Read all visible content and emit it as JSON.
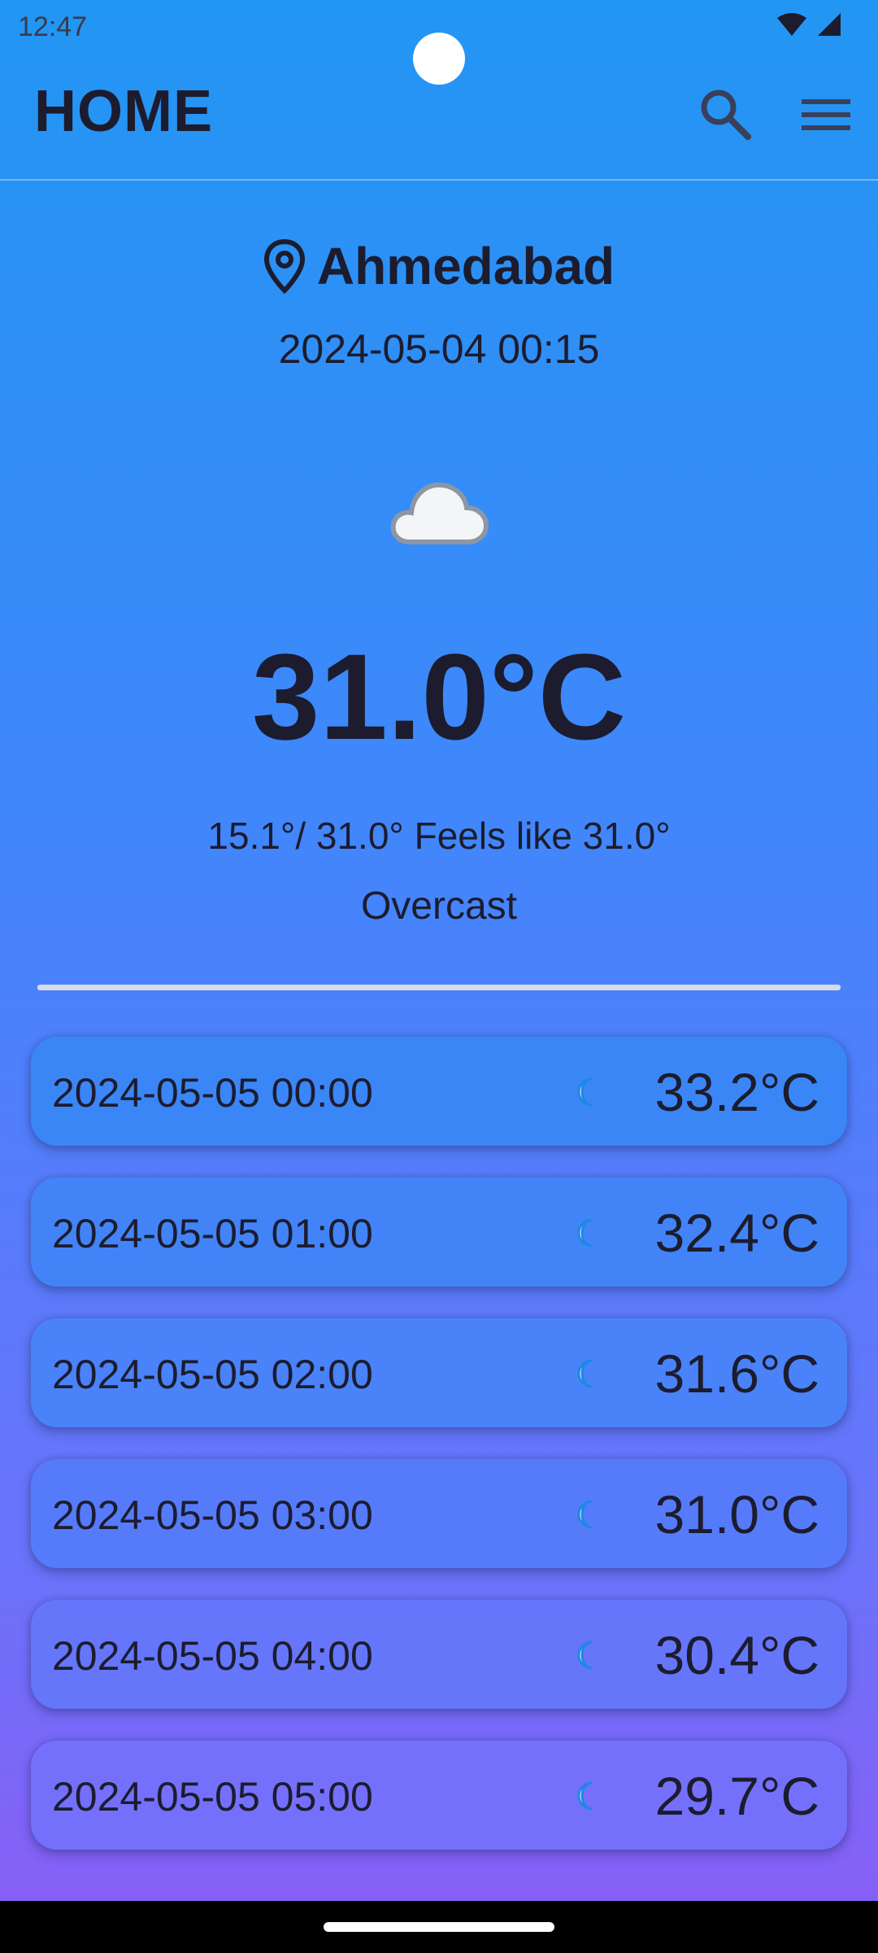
{
  "status_bar": {
    "time": "12:47"
  },
  "app_bar": {
    "title": "HOME",
    "icons": [
      "search-icon",
      "menu-icon"
    ]
  },
  "current": {
    "location": "Ahmedabad",
    "datetime": "2024-05-04 00:15",
    "temperature": "31.0°C",
    "range": "15.1°/ 31.0° Feels like 31.0°",
    "condition": "Overcast",
    "icon": "cloud-icon"
  },
  "forecast": [
    {
      "time": "2024-05-05 00:00",
      "temp": "33.2°C",
      "icon": "moon-icon",
      "color": "#3b86f7"
    },
    {
      "time": "2024-05-05 01:00",
      "temp": "32.4°C",
      "icon": "moon-icon",
      "color": "#4284f8"
    },
    {
      "time": "2024-05-05 02:00",
      "temp": "31.6°C",
      "icon": "moon-icon",
      "color": "#4a82f9"
    },
    {
      "time": "2024-05-05 03:00",
      "temp": "31.0°C",
      "icon": "moon-icon",
      "color": "#567bfa"
    },
    {
      "time": "2024-05-05 04:00",
      "temp": "30.4°C",
      "icon": "moon-icon",
      "color": "#6576fb"
    },
    {
      "time": "2024-05-05 05:00",
      "temp": "29.7°C",
      "icon": "moon-icon",
      "color": "#7570fb"
    }
  ],
  "colors": {
    "gradient_top": "#2296f3",
    "gradient_bottom": "#8b5cf6",
    "text": "#1c1c2e",
    "divider": "#d6dbe6"
  }
}
